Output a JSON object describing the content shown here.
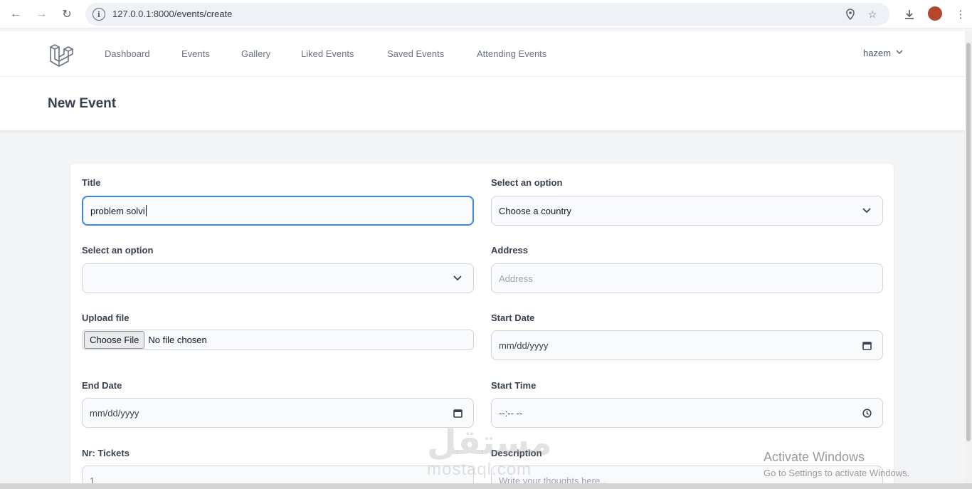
{
  "browser": {
    "url": "127.0.0.1:8000/events/create"
  },
  "nav": {
    "links": [
      "Dashboard",
      "Events",
      "Gallery",
      "Liked Events",
      "Saved Events",
      "Attending Events"
    ],
    "user": "hazem"
  },
  "page": {
    "title": "New Event"
  },
  "form": {
    "title_label": "Title",
    "title_value": "problem solvi",
    "country_label": "Select an option",
    "country_selected": "Choose a country",
    "city_label": "Select an option",
    "city_selected": "",
    "address_label": "Address",
    "address_placeholder": "Address",
    "upload_label": "Upload file",
    "upload_button": "Choose File",
    "upload_status": "No file chosen",
    "start_date_label": "Start Date",
    "start_date_placeholder": "mm/dd/yyyy",
    "end_date_label": "End Date",
    "end_date_placeholder": "mm/dd/yyyy",
    "start_time_label": "Start Time",
    "start_time_placeholder": "--:-- --",
    "tickets_label": "Nr: Tickets",
    "tickets_value": "1",
    "description_label": "Description",
    "description_placeholder": "Write your thoughts here..."
  },
  "watermarks": {
    "brand_arabic": "مستقل",
    "brand_latin": "mostaql.com",
    "activate_title": "Activate Windows",
    "activate_sub": "Go to Settings to activate Windows."
  },
  "colors": {
    "focus": "#3b82f6",
    "profile": "#b5472c"
  }
}
